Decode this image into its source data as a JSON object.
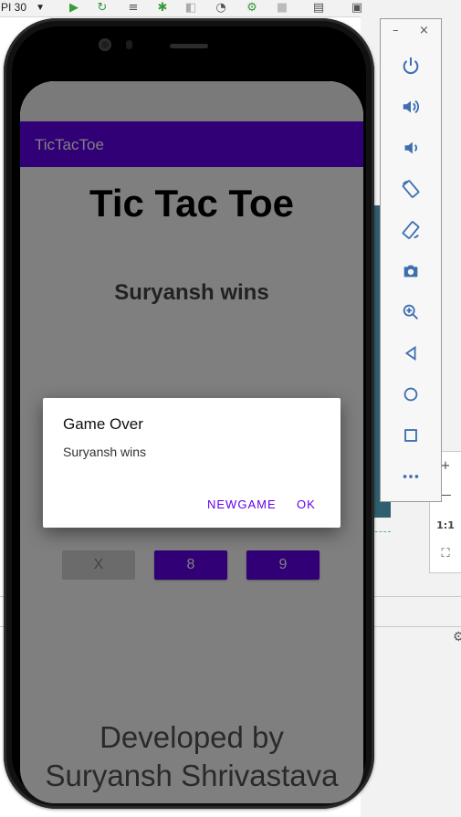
{
  "ide": {
    "api_selector": "PI 30",
    "side_zoom_label": "1:1"
  },
  "app": {
    "app_bar_title": "TicTacToe",
    "title": "Tic Tac Toe",
    "status": "Suryansh wins",
    "board_row": [
      {
        "label": "X",
        "state": "played"
      },
      {
        "label": "8",
        "state": "open"
      },
      {
        "label": "9",
        "state": "open"
      }
    ],
    "footer_line1": "Developed by",
    "footer_line2": "Suryansh Shrivastava"
  },
  "dialog": {
    "title": "Game Over",
    "message": "Suryansh wins",
    "buttons": {
      "new_game": "NEWGAME",
      "ok": "OK"
    }
  },
  "emulator_toolbar": {
    "minimize": "–",
    "close": "×",
    "buttons": [
      "power-icon",
      "volume-up-icon",
      "volume-down-icon",
      "rotate-left-icon",
      "rotate-right-icon",
      "camera-icon",
      "zoom-icon",
      "back-icon",
      "home-icon",
      "overview-icon",
      "more-icon"
    ]
  },
  "colors": {
    "primary": "#6200ee",
    "scrim": "rgba(0,0,0,0.5)"
  }
}
